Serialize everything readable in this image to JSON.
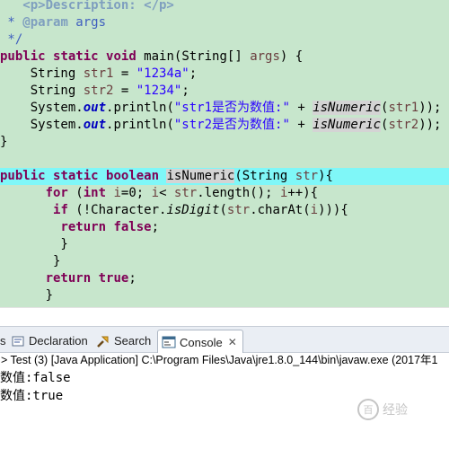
{
  "editor": {
    "lines": [
      {
        "seg": [
          {
            "t": "   <p>Description: </p>",
            "c": "jd"
          }
        ]
      },
      {
        "seg": [
          {
            "t": " * ",
            "c": "cm"
          },
          {
            "t": "@param",
            "c": "jd"
          },
          {
            "t": " args",
            "c": "cm"
          }
        ]
      },
      {
        "seg": [
          {
            "t": " */",
            "c": "cm"
          }
        ]
      },
      {
        "seg": [
          {
            "t": "public",
            "c": "kw"
          },
          {
            "t": " "
          },
          {
            "t": "static",
            "c": "kw"
          },
          {
            "t": " "
          },
          {
            "t": "void",
            "c": "kw"
          },
          {
            "t": " main(String[] "
          },
          {
            "t": "args",
            "c": "var"
          },
          {
            "t": ") {"
          }
        ]
      },
      {
        "seg": [
          {
            "t": "    String "
          },
          {
            "t": "str1",
            "c": "var"
          },
          {
            "t": " = "
          },
          {
            "t": "\"1234a\"",
            "c": "str"
          },
          {
            "t": ";"
          }
        ]
      },
      {
        "seg": [
          {
            "t": "    String "
          },
          {
            "t": "str2",
            "c": "var"
          },
          {
            "t": " = "
          },
          {
            "t": "\"1234\"",
            "c": "str"
          },
          {
            "t": ";"
          }
        ]
      },
      {
        "seg": [
          {
            "t": "    System."
          },
          {
            "t": "out",
            "c": "fld"
          },
          {
            "t": ".println("
          },
          {
            "t": "\"str1是否为数值:\"",
            "c": "str"
          },
          {
            "t": " + "
          },
          {
            "t": "isNumeric",
            "c": "ital mark"
          },
          {
            "t": "("
          },
          {
            "t": "str1",
            "c": "var"
          },
          {
            "t": "));"
          }
        ]
      },
      {
        "seg": [
          {
            "t": "    System."
          },
          {
            "t": "out",
            "c": "fld"
          },
          {
            "t": ".println("
          },
          {
            "t": "\"str2是否为数值:\"",
            "c": "str"
          },
          {
            "t": " + "
          },
          {
            "t": "isNumeric",
            "c": "ital mark"
          },
          {
            "t": "("
          },
          {
            "t": "str2",
            "c": "var"
          },
          {
            "t": "));"
          }
        ]
      },
      {
        "seg": [
          {
            "t": "}"
          }
        ]
      },
      {
        "seg": [
          {
            "t": ""
          }
        ]
      },
      {
        "seg": [
          {
            "t": "public",
            "c": "kw"
          },
          {
            "t": " "
          },
          {
            "t": "static",
            "c": "kw"
          },
          {
            "t": " "
          },
          {
            "t": "boolean",
            "c": "kw"
          },
          {
            "t": " "
          },
          {
            "t": "isNumeric",
            "c": "mark"
          },
          {
            "t": "(String "
          },
          {
            "t": "str",
            "c": "var"
          },
          {
            "t": "){"
          }
        ],
        "current": true
      },
      {
        "seg": [
          {
            "t": "      "
          },
          {
            "t": "for",
            "c": "kw"
          },
          {
            "t": " ("
          },
          {
            "t": "int",
            "c": "kw"
          },
          {
            "t": " "
          },
          {
            "t": "i",
            "c": "var"
          },
          {
            "t": "=0; "
          },
          {
            "t": "i",
            "c": "var"
          },
          {
            "t": "< "
          },
          {
            "t": "str",
            "c": "var"
          },
          {
            "t": ".length(); "
          },
          {
            "t": "i",
            "c": "var"
          },
          {
            "t": "++){"
          }
        ]
      },
      {
        "seg": [
          {
            "t": "       "
          },
          {
            "t": "if",
            "c": "kw"
          },
          {
            "t": " (!Character."
          },
          {
            "t": "isDigit",
            "c": "ital"
          },
          {
            "t": "("
          },
          {
            "t": "str",
            "c": "var"
          },
          {
            "t": ".charAt("
          },
          {
            "t": "i",
            "c": "var"
          },
          {
            "t": "))){"
          }
        ]
      },
      {
        "seg": [
          {
            "t": "        "
          },
          {
            "t": "return",
            "c": "kw"
          },
          {
            "t": " "
          },
          {
            "t": "false",
            "c": "kw"
          },
          {
            "t": ";"
          }
        ]
      },
      {
        "seg": [
          {
            "t": "        }"
          }
        ]
      },
      {
        "seg": [
          {
            "t": "       }"
          }
        ]
      },
      {
        "seg": [
          {
            "t": "      "
          },
          {
            "t": "return",
            "c": "kw"
          },
          {
            "t": " "
          },
          {
            "t": "true",
            "c": "kw"
          },
          {
            "t": ";"
          }
        ]
      },
      {
        "seg": [
          {
            "t": "      }"
          }
        ]
      }
    ]
  },
  "panel": {
    "tabs": [
      {
        "label": "s",
        "icon": "problems-icon",
        "active": false
      },
      {
        "label": "Declaration",
        "icon": "declaration-icon",
        "active": false
      },
      {
        "label": "Search",
        "icon": "search-icon",
        "active": false
      },
      {
        "label": "Console",
        "icon": "console-icon",
        "active": true
      }
    ],
    "close_glyph": "✕",
    "console_desc": "> Test (3) [Java Application] C:\\Program Files\\Java\\jre1.8.0_144\\bin\\javaw.exe (2017年1",
    "console_lines": [
      "数值:false",
      "数值:true"
    ]
  },
  "watermark": {
    "text": "经验",
    "badge": "百"
  }
}
